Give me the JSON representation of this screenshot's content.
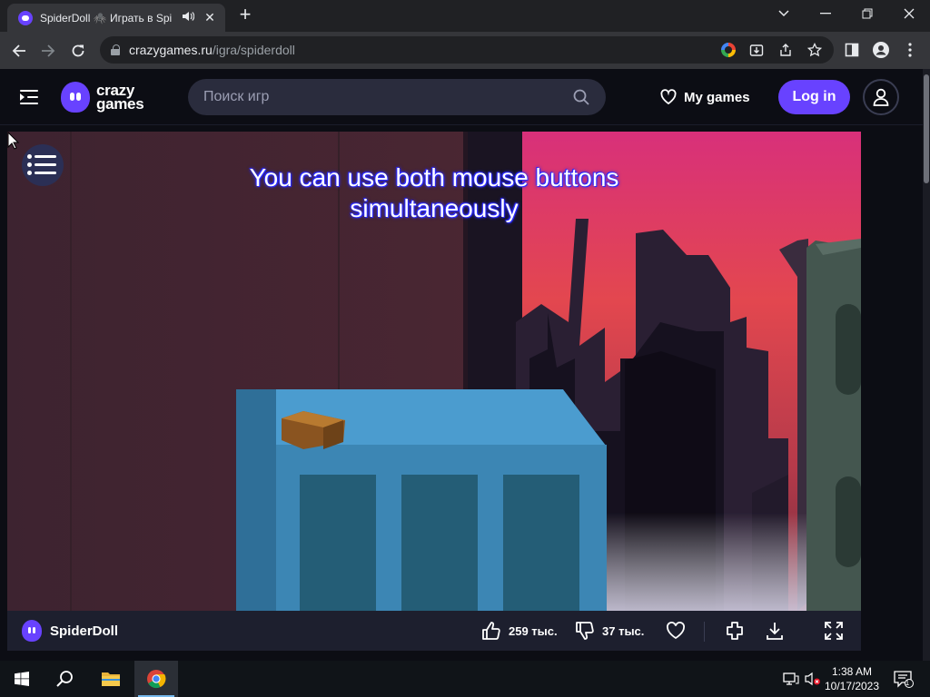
{
  "browser": {
    "tab": {
      "title": "SpiderDoll 🕷️ Играть в Spi",
      "speaker_icon": "speaker-icon",
      "close_glyph": "✕"
    },
    "new_tab_glyph": "+",
    "window_controls": {
      "minimize": "—",
      "restore": "❐",
      "close": "✕",
      "tab_search": "⌄"
    },
    "url_host": "crazygames.ru",
    "url_path": "/igra/spiderdoll"
  },
  "site": {
    "logo_line1": "crazy",
    "logo_line2": "games",
    "search_placeholder": "Поиск игр",
    "my_games_label": "My games",
    "login_label": "Log in",
    "brand_color": "#6842ff"
  },
  "game": {
    "hint_text": "You can use both mouse buttons simultaneously",
    "title": "SpiderDoll",
    "likes": "259 тыс.",
    "dislikes": "37 тыс."
  },
  "taskbar": {
    "time": "1:38 AM",
    "date": "10/17/2023",
    "notification_count": "1"
  }
}
